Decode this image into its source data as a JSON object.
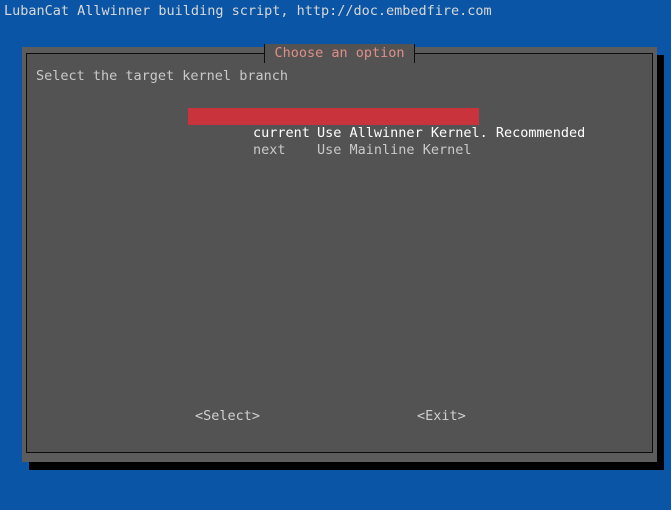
{
  "terminal": {
    "title": "LubanCat Allwinner building script, http://doc.embedfire.com",
    "background_color": "#0a55a5",
    "text_color": "#d8d8d8"
  },
  "dialog": {
    "title": "Choose an option",
    "title_color": "#e08f88",
    "prompt": "Select the target kernel branch",
    "panel_color": "#535353",
    "frame_color": "#5c5c5c",
    "border_color": "#0d0d0d",
    "shadow_color": "#000000",
    "highlight_color": "#c8333c",
    "options": [
      {
        "tag": "current",
        "description": "Use Allwinner Kernel. Recommended",
        "selected": true
      },
      {
        "tag": "next",
        "description": "Use Mainline Kernel",
        "selected": false
      }
    ],
    "buttons": {
      "select_label": "<Select>",
      "exit_label": "<Exit>"
    }
  }
}
